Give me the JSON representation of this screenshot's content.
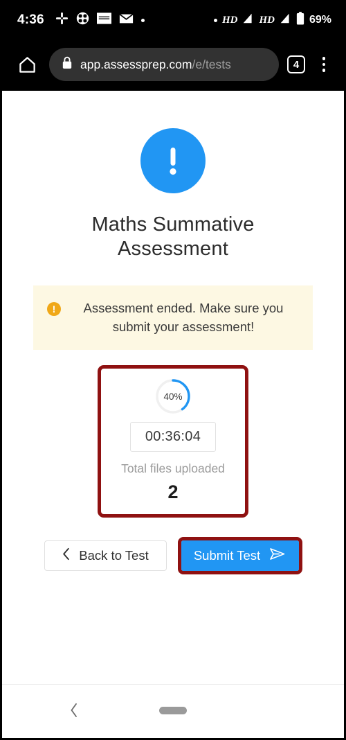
{
  "status_bar": {
    "clock": "4:36",
    "icons": [
      "slack-icon",
      "circle-quad-icon",
      "rectangle-badge-icon",
      "envelope-icon",
      "dot-icon"
    ],
    "network_dot": "dot-icon",
    "hd_label_1": "HD",
    "signal_1": "signal-bars-icon",
    "hd_label_2": "HD",
    "signal_2": "signal-bars-icon",
    "battery_icon": "battery-icon",
    "battery_percent": "69%"
  },
  "browser": {
    "home_icon": "home-icon",
    "lock_icon": "lock-icon",
    "url_host": "app.assessprep.com",
    "url_path": "/e/tests",
    "tab_count": "4",
    "menu_icon": "overflow-menu-icon"
  },
  "page": {
    "alert_icon": "exclamation-icon",
    "title": "Maths Summative Assessment",
    "warning": {
      "icon": "warning-exclamation-icon",
      "text": "Assessment ended. Make sure you submit your assessment!"
    },
    "stats": {
      "progress_percent": "40%",
      "progress_value": 40,
      "timer": "00:36:04",
      "files_label": "Total files uploaded",
      "files_count": "2"
    },
    "buttons": {
      "back_icon": "chevron-left-icon",
      "back_label": "Back to Test",
      "submit_label": "Submit Test",
      "submit_icon": "send-plane-icon"
    }
  },
  "bottom_nav": {
    "back_icon": "nav-back-icon",
    "home_pill": "home-indicator-pill"
  },
  "colors": {
    "accent_blue": "#2196f3",
    "warning_amber": "#f0a818",
    "banner_bg": "#fdf8e3",
    "highlight_red": "#8f1111",
    "status_bar_bg": "#000000"
  }
}
